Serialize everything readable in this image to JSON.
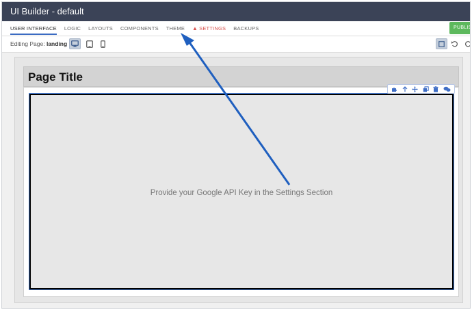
{
  "window": {
    "title": "UI Builder - default"
  },
  "tabs": [
    {
      "label": "USER INTERFACE",
      "active": true
    },
    {
      "label": "LOGIC"
    },
    {
      "label": "LAYOUTS"
    },
    {
      "label": "COMPONENTS"
    },
    {
      "label": "THEME"
    },
    {
      "label": "SETTINGS",
      "warning": true
    },
    {
      "label": "BACKUPS"
    }
  ],
  "header": {
    "publish_label": "PUBLISH"
  },
  "toolbar": {
    "editing_prefix": "Editing Page:",
    "page_name": "landing",
    "devices": [
      {
        "icon": "desktop-icon",
        "selected": true
      },
      {
        "icon": "tablet-icon"
      },
      {
        "icon": "phone-icon"
      }
    ],
    "right_actions": [
      "frame-toggle-icon",
      "undo-icon",
      "redo-icon"
    ]
  },
  "canvas": {
    "page_title": "Page Title",
    "map_message": "Provide your Google API Key in the Settings Section",
    "component_actions": [
      "puzzle-icon",
      "arrow-up-icon",
      "move-icon",
      "copy-icon",
      "trash-icon",
      "chat-icon"
    ]
  },
  "colors": {
    "titlebar": "#3b4357",
    "accent": "#3b6bc2",
    "warning": "#d9534f",
    "publish": "#5cb85c",
    "annotation_arrow": "#1f5fbf"
  }
}
